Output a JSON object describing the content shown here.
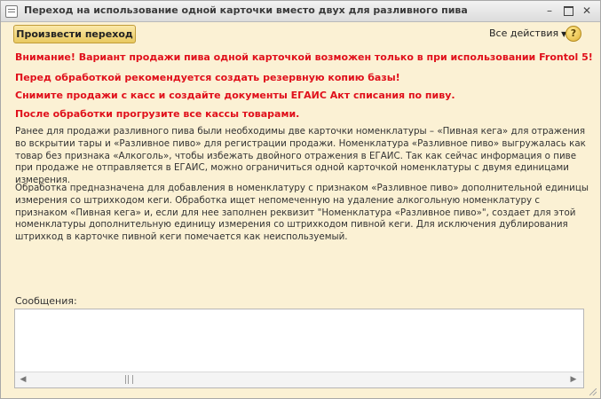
{
  "window": {
    "title": "Переход на использование одной карточки вместо двух для разливного пива",
    "buttons": {
      "minimize": "–",
      "close": "✕"
    }
  },
  "toolbar": {
    "run_button": "Произвести переход",
    "all_actions": "Все действия",
    "all_actions_arrow": "▼",
    "help": "?"
  },
  "warnings": [
    "Внимание! Вариант продажи пива одной карточкой возможен только в при использовании Frontol 5!",
    "Перед обработкой рекомендуется создать резервную копию базы!",
    "Снимите продажи с касс и создайте документы ЕГАИС Акт списания по пиву.",
    "После обработки прогрузите все кассы товарами."
  ],
  "description": [
    "Ранее для продажи разливного пива были необходимы две карточки номенклатуры – «Пивная кега» для отражения во вскрытии тары и «Разливное пиво» для регистрации продажи. Номенклатура «Разливное пиво» выгружалась как товар без признака «Алкоголь», чтобы избежать двойного отражения в ЕГАИС. Так как сейчас информация о пиве при продаже не отправляется в ЕГАИС, можно ограничиться одной карточкой номенклатуры с двумя единицами измерения.",
    "Обработка предназначена для добавления в номенклатуру с признаком «Разливное пиво» дополнительной единицы измерения со штрихкодом кеги. Обработка ищет непомеченную на удаление алкогольную номенклатуру с признаком «Пивная кега» и, если для нее заполнен реквизит \"Номенклатура «Разливное пиво»\", создает для этой номенклатуры дополнительную единицу измерения со штрихкодом пивной кеги. Для исключения дублирования штрихкод в карточке пивной кеги помечается как неиспользуемый."
  ],
  "messages": {
    "label": "Сообщения:",
    "scroll_left": "◀",
    "scroll_right": "▶"
  },
  "colors": {
    "window_bg": "#fbf1d4",
    "warning_text": "#e0101b",
    "button_bg": "#f0d276"
  }
}
